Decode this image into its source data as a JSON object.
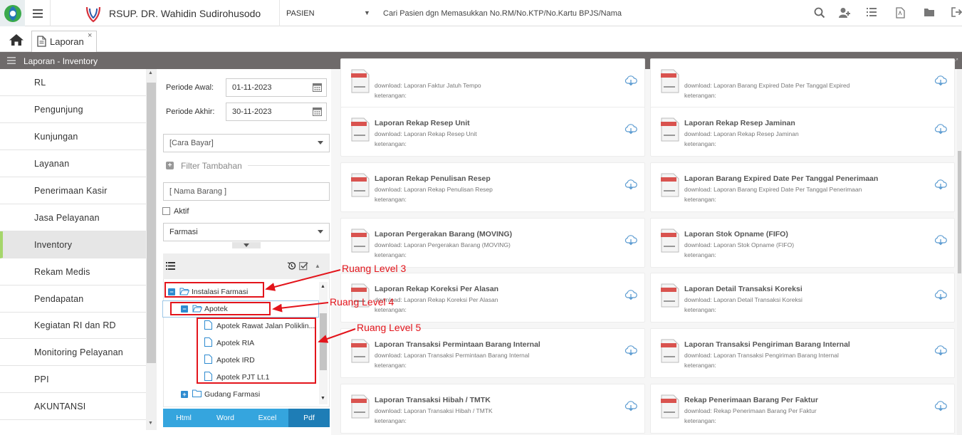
{
  "topbar": {
    "hospital_name": "RSUP. DR. Wahidin Sudirohusodo",
    "mode": "PASIEN",
    "search_placeholder": "Cari Pasien dgn Memasukkan No.RM/No.KTP/No.Kartu BPJS/Nama",
    "icons": [
      "search-icon",
      "add-user-icon",
      "list-icon",
      "pdf-file-icon",
      "folder-icon",
      "logout-icon"
    ]
  },
  "tabs": [
    {
      "label": "Laporan",
      "close": "×"
    }
  ],
  "section": {
    "title": "Laporan - Inventory"
  },
  "sidebar": {
    "items": [
      {
        "label": "RL"
      },
      {
        "label": "Pengunjung"
      },
      {
        "label": "Kunjungan"
      },
      {
        "label": "Layanan"
      },
      {
        "label": "Penerimaan Kasir"
      },
      {
        "label": "Jasa Pelayanan"
      },
      {
        "label": "Inventory",
        "active": true
      },
      {
        "label": "Rekam Medis"
      },
      {
        "label": "Pendapatan"
      },
      {
        "label": "Kegiatan RI dan RD"
      },
      {
        "label": "Monitoring Pelayanan"
      },
      {
        "label": "PPI"
      },
      {
        "label": "AKUNTANSI"
      }
    ]
  },
  "filters": {
    "periode_awal_label": "Periode Awal:",
    "periode_awal_value": "01-11-2023",
    "periode_akhir_label": "Periode Akhir:",
    "periode_akhir_value": "30-11-2023",
    "cara_bayar": "[Cara Bayar]",
    "filter_tambahan": "Filter Tambahan",
    "nama_barang_placeholder": "[ Nama Barang ]",
    "aktif_label": "Aktif",
    "aktif_checked": false,
    "farmasi": "Farmasi"
  },
  "tree": {
    "nodes": [
      {
        "label": "Instalasi Farmasi",
        "level": 3,
        "expanded": true
      },
      {
        "label": "Apotek",
        "level": 4,
        "expanded": true
      },
      {
        "label": "Apotek Rawat Jalan Poliklin...",
        "level": 5
      },
      {
        "label": "Apotek RIA",
        "level": 5
      },
      {
        "label": "Apotek IRD",
        "level": 5
      },
      {
        "label": "Apotek PJT Lt.1",
        "level": 5
      },
      {
        "label": "Gudang Farmasi",
        "level": 4,
        "expanded": false
      }
    ]
  },
  "export": {
    "html": "Html",
    "word": "Word",
    "excel": "Excel",
    "pdf": "Pdf"
  },
  "annotations": {
    "level3": "Ruang Level 3",
    "level4": "Ruang Level 4",
    "level5": "Ruang Level 5",
    "color": "#e3141b"
  },
  "reports": {
    "download_prefix": "download: ",
    "keterangan_label": "keterangan:",
    "cards": [
      {
        "title": "",
        "download": "Laporan Faktur Jatuh Tempo"
      },
      {
        "title": "",
        "download": "Laporan Barang Expired Date Per Tanggal Expired"
      },
      {
        "title": "Laporan Rekap Resep Unit",
        "download": "Laporan Rekap Resep Unit"
      },
      {
        "title": "Laporan Rekap Resep Jaminan",
        "download": "Laporan Rekap Resep Jaminan"
      },
      {
        "title": "Laporan Rekap Penulisan Resep",
        "download": "Laporan Rekap Penulisan Resep"
      },
      {
        "title": "Laporan Barang Expired Date Per Tanggal Penerimaan",
        "download": "Laporan Barang Expired Date Per Tanggal Penerimaan"
      },
      {
        "title": "Laporan Pergerakan Barang (MOVING)",
        "download": "Laporan Pergerakan Barang (MOVING)"
      },
      {
        "title": "Laporan Stok Opname (FIFO)",
        "download": "Laporan Stok Opname (FIFO)"
      },
      {
        "title": "Laporan Rekap Koreksi Per Alasan",
        "download": "Laporan Rekap Koreksi Per Alasan"
      },
      {
        "title": "Laporan Detail Transaksi Koreksi",
        "download": "Laporan Detail Transaksi Koreksi"
      },
      {
        "title": "Laporan Transaksi Permintaan Barang Internal",
        "download": "Laporan Transaksi Permintaan Barang Internal"
      },
      {
        "title": "Laporan Transaksi Pengiriman Barang Internal",
        "download": "Laporan Transaksi Pengiriman Barang Internal"
      },
      {
        "title": "Laporan Transaksi Hibah / TMTK",
        "download": "Laporan Transaksi Hibah / TMTK"
      },
      {
        "title": "Rekap Penerimaan Barang Per Faktur",
        "download": "Rekap Penerimaan Barang Per Faktur"
      }
    ]
  }
}
